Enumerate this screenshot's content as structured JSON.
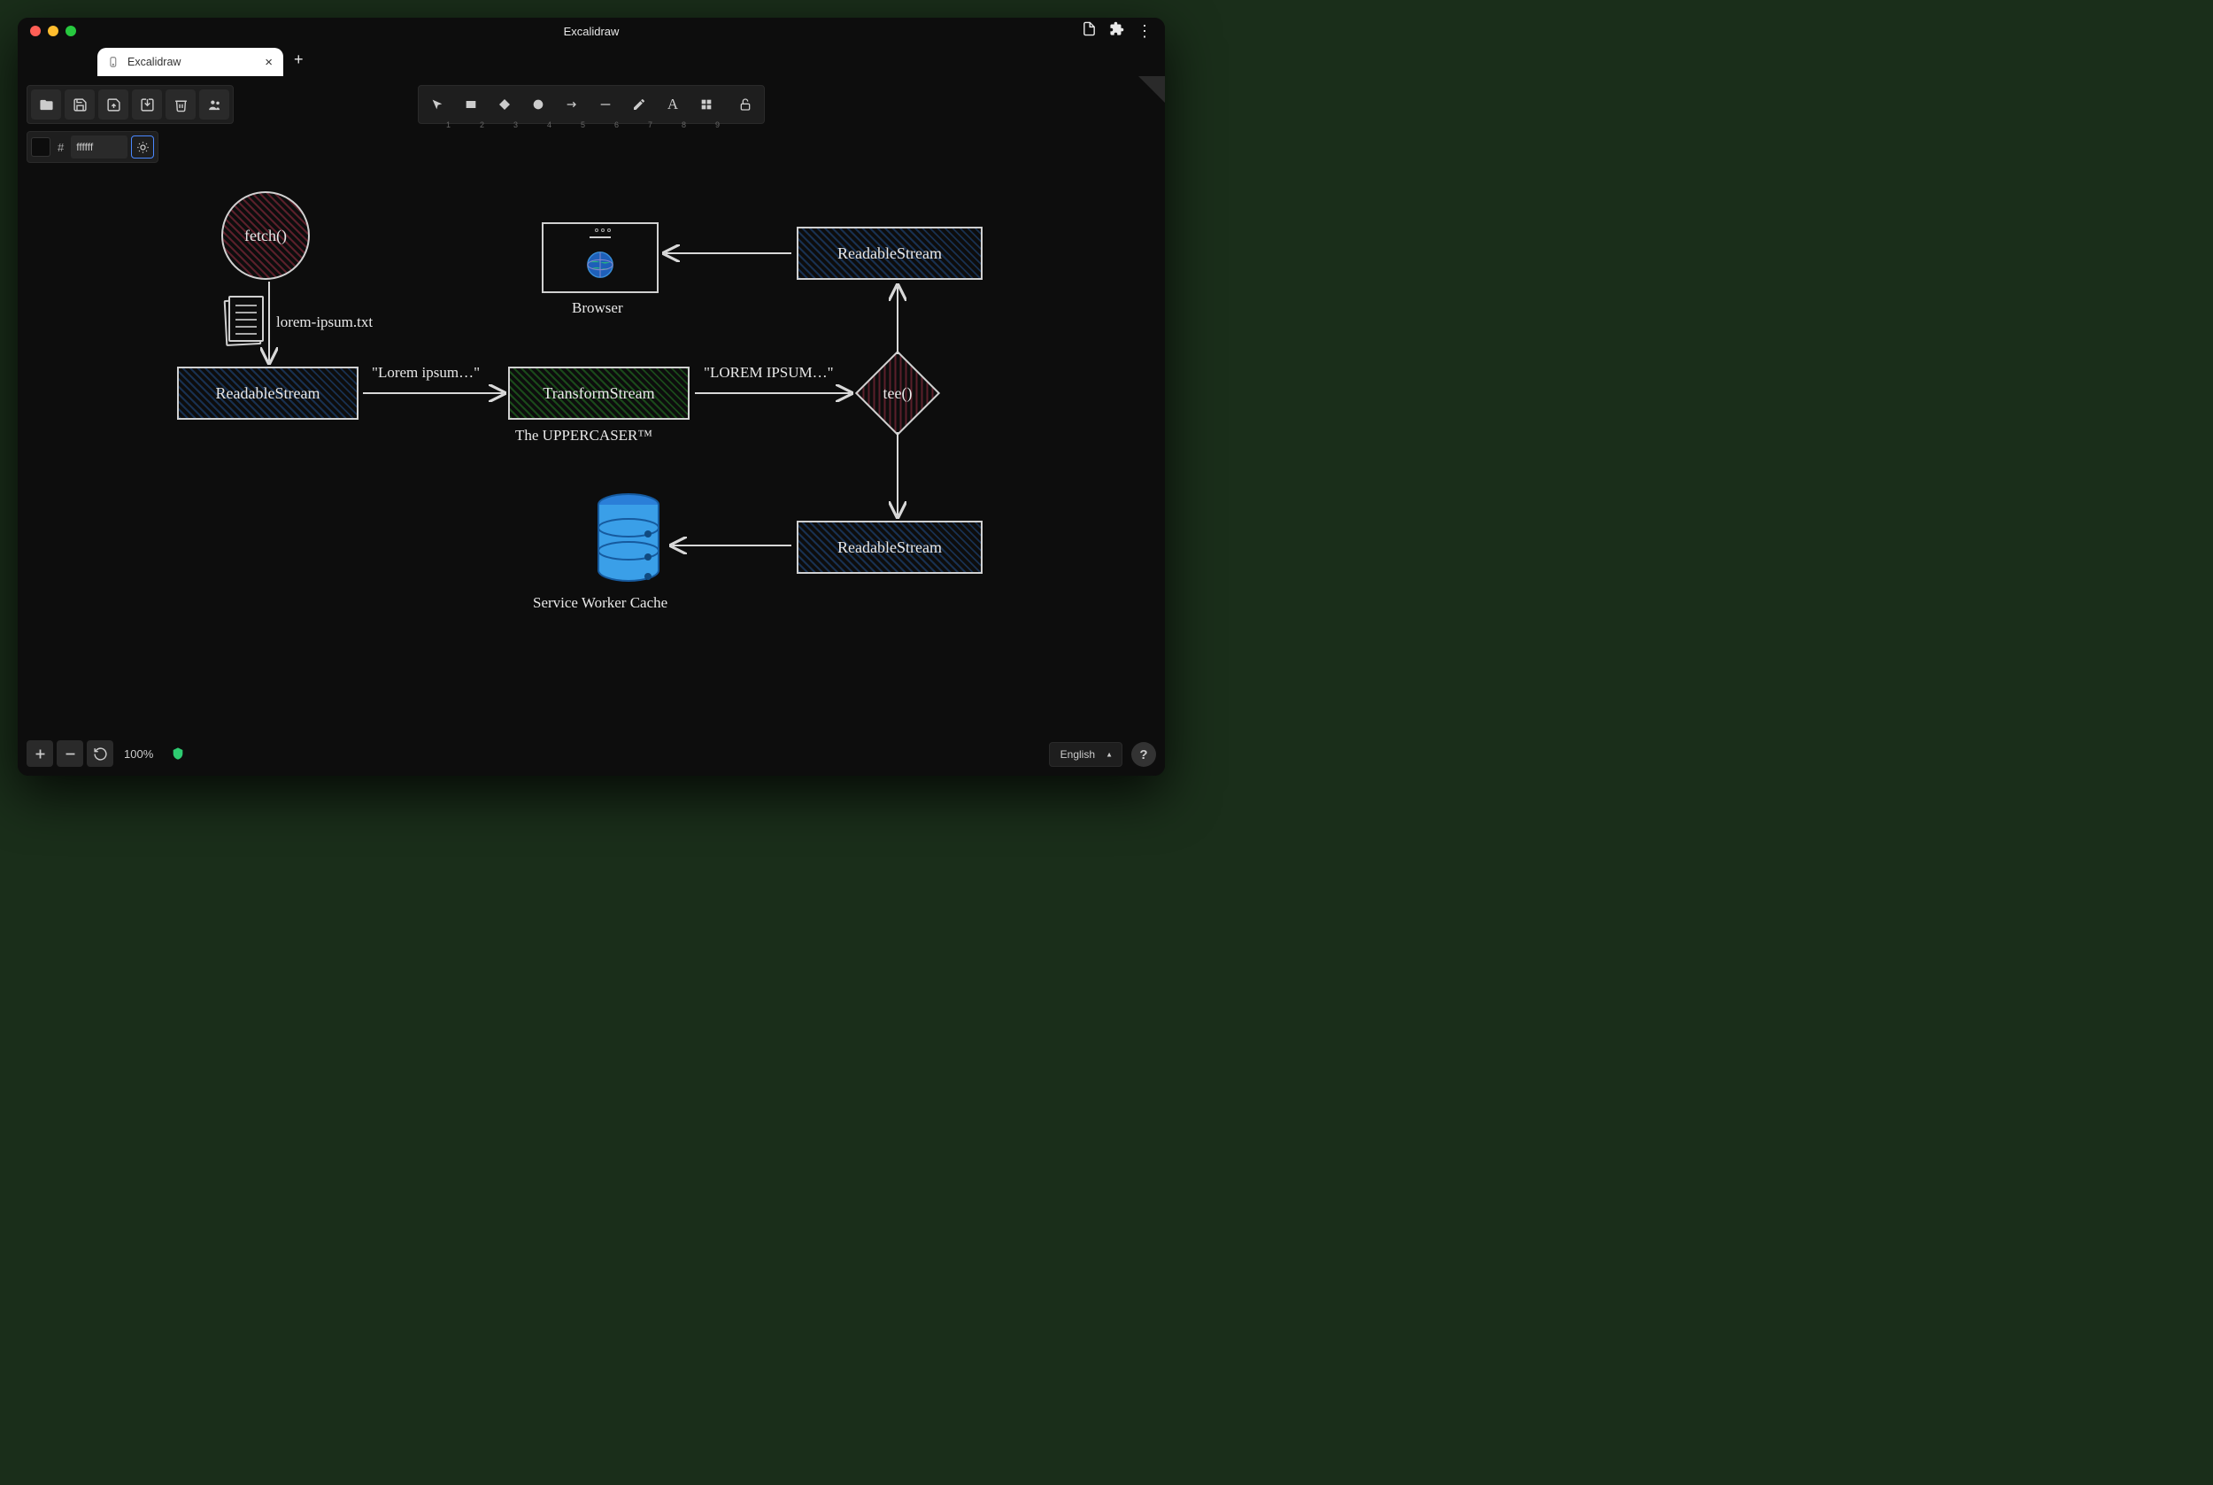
{
  "window": {
    "title": "Excalidraw",
    "tab_title": "Excalidraw"
  },
  "toolbar": {
    "tools": [
      "1",
      "2",
      "3",
      "4",
      "5",
      "6",
      "7",
      "8",
      "9"
    ]
  },
  "color": {
    "value": "ffffff"
  },
  "zoom": {
    "label": "100%"
  },
  "language": {
    "selected": "English"
  },
  "diagram": {
    "fetch_label": "fetch()",
    "file_label": "lorem-ipsum.txt",
    "readable1": "ReadableStream",
    "lorem_lower": "\"Lorem ipsum…\"",
    "transform": "TransformStream",
    "transform_sub": "The UPPERCASER™",
    "lorem_upper": "\"LOREM IPSUM…\"",
    "tee": "tee()",
    "readable2": "ReadableStream",
    "readable3": "ReadableStream",
    "browser_label": "Browser",
    "cache_label": "Service Worker Cache"
  }
}
